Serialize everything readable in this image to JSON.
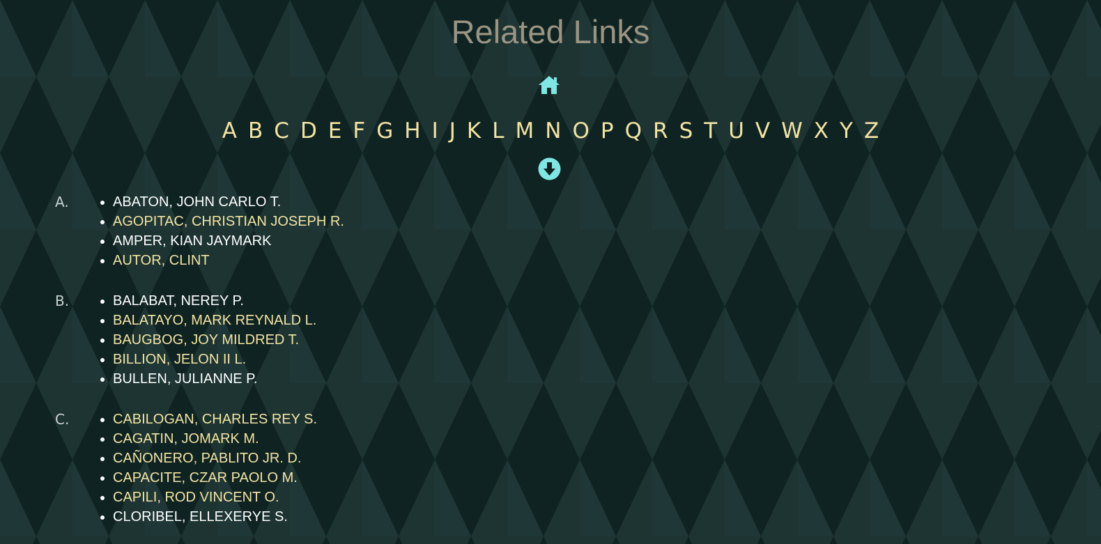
{
  "page": {
    "title": "Related Links",
    "home_icon": "home-icon",
    "down_icon": "arrow-circle-down-icon"
  },
  "alphabet": [
    "A",
    "B",
    "C",
    "D",
    "E",
    "F",
    "G",
    "H",
    "I",
    "J",
    "K",
    "L",
    "M",
    "N",
    "O",
    "P",
    "Q",
    "R",
    "S",
    "T",
    "U",
    "V",
    "W",
    "X",
    "Y",
    "Z"
  ],
  "groups": [
    {
      "label": "A.",
      "names": [
        {
          "text": "ABATON, JOHN CARLO T.",
          "color": "white"
        },
        {
          "text": "AGOPITAC, CHRISTIAN JOSEPH R.",
          "color": "yellow"
        },
        {
          "text": "AMPER, KIAN JAYMARK",
          "color": "white"
        },
        {
          "text": "AUTOR, CLINT",
          "color": "yellow"
        }
      ]
    },
    {
      "label": "B.",
      "names": [
        {
          "text": "BALABAT, NEREY P.",
          "color": "white"
        },
        {
          "text": "BALATAYO, MARK REYNALD L.",
          "color": "yellow"
        },
        {
          "text": "BAUGBOG, JOY MILDRED T.",
          "color": "yellow"
        },
        {
          "text": "BILLION, JELON II L.",
          "color": "yellow"
        },
        {
          "text": "BULLEN, JULIANNE P.",
          "color": "white"
        }
      ]
    },
    {
      "label": "C.",
      "names": [
        {
          "text": "CABILOGAN, CHARLES REY S.",
          "color": "yellow"
        },
        {
          "text": "CAGATIN, JOMARK M.",
          "color": "yellow"
        },
        {
          "text": "CAÑONERO, PABLITO JR. D.",
          "color": "yellow"
        },
        {
          "text": "CAPACITE, CZAR PAOLO M.",
          "color": "yellow"
        },
        {
          "text": "CAPILI, ROD VINCENT O.",
          "color": "yellow"
        },
        {
          "text": "CLORIBEL, ELLEXERYE S.",
          "color": "white"
        }
      ]
    }
  ],
  "colors": {
    "background": "#0f2322",
    "title": "#9a9482",
    "accent_yellow": "#f3e4a4",
    "icon_cyan": "#7fe6e4",
    "white": "#ffffff"
  }
}
